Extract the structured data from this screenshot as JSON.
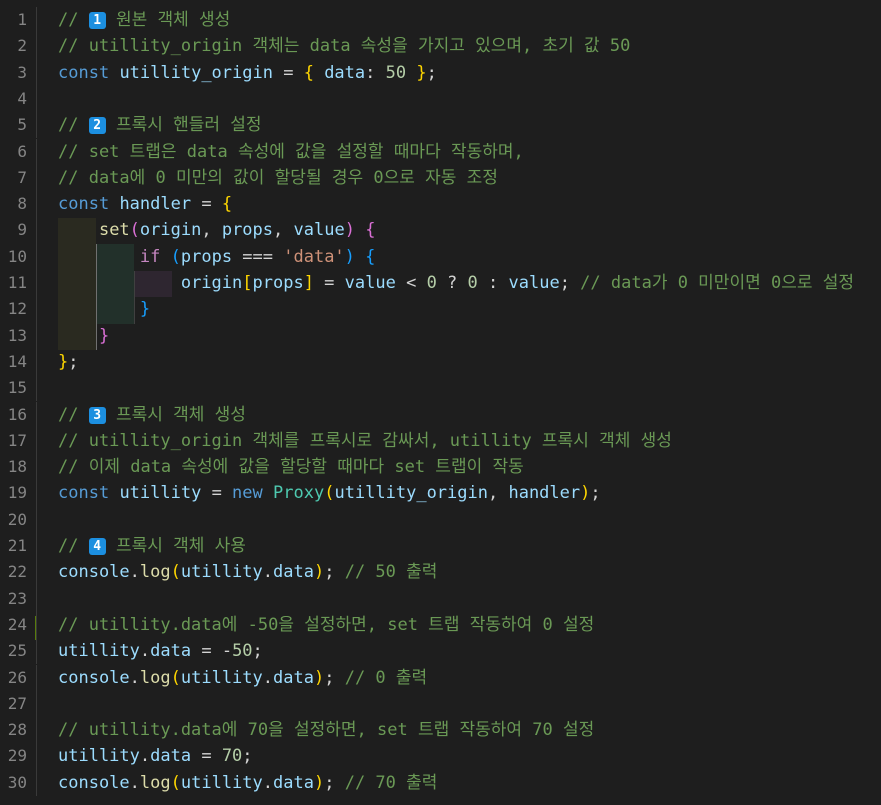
{
  "editor": {
    "colors": {
      "background": "#1e1e1e",
      "line_number": "#858585",
      "comment": "#6a9955",
      "keyword": "#569cd6",
      "control": "#c586c0",
      "variable": "#9cdcfe",
      "class": "#4ec9b0",
      "function": "#dcdcaa",
      "number": "#b5cea8",
      "string": "#ce9178",
      "bracket_1": "#ffd700",
      "bracket_2": "#da70d6",
      "bracket_3": "#179fff",
      "badge": "#1c8fe0",
      "modified_bar": "#587c0c"
    },
    "lines": [
      {
        "n": "1",
        "tokens": [
          [
            "comment",
            "// "
          ],
          [
            "badge",
            "1"
          ],
          [
            "comment",
            " 원본 객체 생성"
          ]
        ]
      },
      {
        "n": "2",
        "tokens": [
          [
            "comment",
            "// utillity_origin 객체는 data 속성을 가지고 있으며, 초기 값 50"
          ]
        ]
      },
      {
        "n": "3",
        "tokens": [
          [
            "kw",
            "const"
          ],
          [
            "op",
            " "
          ],
          [
            "var",
            "utillity_origin"
          ],
          [
            "op",
            " = "
          ],
          [
            "b1",
            "{"
          ],
          [
            "op",
            " "
          ],
          [
            "var",
            "data"
          ],
          [
            "op",
            ": "
          ],
          [
            "num",
            "50"
          ],
          [
            "op",
            " "
          ],
          [
            "b1",
            "}"
          ],
          [
            "op",
            ";"
          ]
        ]
      },
      {
        "n": "4",
        "tokens": []
      },
      {
        "n": "5",
        "tokens": [
          [
            "comment",
            "// "
          ],
          [
            "badge",
            "2"
          ],
          [
            "comment",
            " 프록시 핸들러 설정"
          ]
        ]
      },
      {
        "n": "6",
        "tokens": [
          [
            "comment",
            "// set 트랩은 data 속성에 값을 설정할 때마다 작동하며,"
          ]
        ]
      },
      {
        "n": "7",
        "tokens": [
          [
            "comment",
            "// data에 0 미만의 값이 할당될 경우 0으로 자동 조정"
          ]
        ]
      },
      {
        "n": "8",
        "tokens": [
          [
            "kw",
            "const"
          ],
          [
            "op",
            " "
          ],
          [
            "var",
            "handler"
          ],
          [
            "op",
            " = "
          ],
          [
            "b1",
            "{"
          ]
        ]
      },
      {
        "n": "9",
        "tokens": [
          [
            "op",
            "    "
          ],
          [
            "fn",
            "set"
          ],
          [
            "b2",
            "("
          ],
          [
            "var",
            "origin"
          ],
          [
            "op",
            ", "
          ],
          [
            "var",
            "props"
          ],
          [
            "op",
            ", "
          ],
          [
            "var",
            "value"
          ],
          [
            "b2",
            ")"
          ],
          [
            "op",
            " "
          ],
          [
            "b2",
            "{"
          ]
        ]
      },
      {
        "n": "10",
        "tokens": [
          [
            "op",
            "        "
          ],
          [
            "ctrl",
            "if"
          ],
          [
            "op",
            " "
          ],
          [
            "b3",
            "("
          ],
          [
            "var",
            "props"
          ],
          [
            "op",
            " === "
          ],
          [
            "str",
            "'data'"
          ],
          [
            "b3",
            ")"
          ],
          [
            "op",
            " "
          ],
          [
            "b3",
            "{"
          ]
        ]
      },
      {
        "n": "11",
        "tokens": [
          [
            "op",
            "            "
          ],
          [
            "var",
            "origin"
          ],
          [
            "b1",
            "["
          ],
          [
            "var",
            "props"
          ],
          [
            "b1",
            "]"
          ],
          [
            "op",
            " = "
          ],
          [
            "var",
            "value"
          ],
          [
            "op",
            " < "
          ],
          [
            "num",
            "0"
          ],
          [
            "op",
            " ? "
          ],
          [
            "num",
            "0"
          ],
          [
            "op",
            " : "
          ],
          [
            "var",
            "value"
          ],
          [
            "op",
            "; "
          ],
          [
            "comment",
            "// data가 0 미만이면 0으로 설정"
          ]
        ]
      },
      {
        "n": "12",
        "tokens": [
          [
            "op",
            "        "
          ],
          [
            "b3",
            "}"
          ]
        ]
      },
      {
        "n": "13",
        "tokens": [
          [
            "op",
            "    "
          ],
          [
            "b2",
            "}"
          ]
        ]
      },
      {
        "n": "14",
        "tokens": [
          [
            "b1",
            "}"
          ],
          [
            "op",
            ";"
          ]
        ]
      },
      {
        "n": "15",
        "tokens": []
      },
      {
        "n": "16",
        "tokens": [
          [
            "comment",
            "// "
          ],
          [
            "badge",
            "3"
          ],
          [
            "comment",
            " 프록시 객체 생성"
          ]
        ]
      },
      {
        "n": "17",
        "tokens": [
          [
            "comment",
            "// utillity_origin 객체를 프록시로 감싸서, utillity 프록시 객체 생성"
          ]
        ]
      },
      {
        "n": "18",
        "tokens": [
          [
            "comment",
            "// 이제 data 속성에 값을 할당할 때마다 set 트랩이 작동"
          ]
        ]
      },
      {
        "n": "19",
        "tokens": [
          [
            "kw",
            "const"
          ],
          [
            "op",
            " "
          ],
          [
            "var",
            "utillity"
          ],
          [
            "op",
            " = "
          ],
          [
            "kw",
            "new"
          ],
          [
            "op",
            " "
          ],
          [
            "cls",
            "Proxy"
          ],
          [
            "b1",
            "("
          ],
          [
            "var",
            "utillity_origin"
          ],
          [
            "op",
            ", "
          ],
          [
            "var",
            "handler"
          ],
          [
            "b1",
            ")"
          ],
          [
            "op",
            ";"
          ]
        ]
      },
      {
        "n": "20",
        "tokens": []
      },
      {
        "n": "21",
        "tokens": [
          [
            "comment",
            "// "
          ],
          [
            "badge",
            "4"
          ],
          [
            "comment",
            " 프록시 객체 사용"
          ]
        ]
      },
      {
        "n": "22",
        "tokens": [
          [
            "var",
            "console"
          ],
          [
            "op",
            "."
          ],
          [
            "fn",
            "log"
          ],
          [
            "b1",
            "("
          ],
          [
            "var",
            "utillity"
          ],
          [
            "op",
            "."
          ],
          [
            "var",
            "data"
          ],
          [
            "b1",
            ")"
          ],
          [
            "op",
            "; "
          ],
          [
            "comment",
            "// 50 출력"
          ]
        ]
      },
      {
        "n": "23",
        "tokens": []
      },
      {
        "n": "24",
        "tokens": [
          [
            "comment",
            "// utillity.data에 -50을 설정하면, set 트랩 작동하여 0 설정"
          ]
        ]
      },
      {
        "n": "25",
        "tokens": [
          [
            "var",
            "utillity"
          ],
          [
            "op",
            "."
          ],
          [
            "var",
            "data"
          ],
          [
            "op",
            " = "
          ],
          [
            "op",
            "-"
          ],
          [
            "num",
            "50"
          ],
          [
            "op",
            ";"
          ]
        ]
      },
      {
        "n": "26",
        "tokens": [
          [
            "var",
            "console"
          ],
          [
            "op",
            "."
          ],
          [
            "fn",
            "log"
          ],
          [
            "b1",
            "("
          ],
          [
            "var",
            "utillity"
          ],
          [
            "op",
            "."
          ],
          [
            "var",
            "data"
          ],
          [
            "b1",
            ")"
          ],
          [
            "op",
            "; "
          ],
          [
            "comment",
            "// 0 출력"
          ]
        ]
      },
      {
        "n": "27",
        "tokens": []
      },
      {
        "n": "28",
        "tokens": [
          [
            "comment",
            "// utillity.data에 70을 설정하면, set 트랩 작동하여 70 설정"
          ]
        ]
      },
      {
        "n": "29",
        "tokens": [
          [
            "var",
            "utillity"
          ],
          [
            "op",
            "."
          ],
          [
            "var",
            "data"
          ],
          [
            "op",
            " = "
          ],
          [
            "num",
            "70"
          ],
          [
            "op",
            ";"
          ]
        ]
      },
      {
        "n": "30",
        "tokens": [
          [
            "var",
            "console"
          ],
          [
            "op",
            "."
          ],
          [
            "fn",
            "log"
          ],
          [
            "b1",
            "("
          ],
          [
            "var",
            "utillity"
          ],
          [
            "op",
            "."
          ],
          [
            "var",
            "data"
          ],
          [
            "b1",
            ")"
          ],
          [
            "op",
            "; "
          ],
          [
            "comment",
            "// 70 출력"
          ]
        ]
      }
    ]
  }
}
